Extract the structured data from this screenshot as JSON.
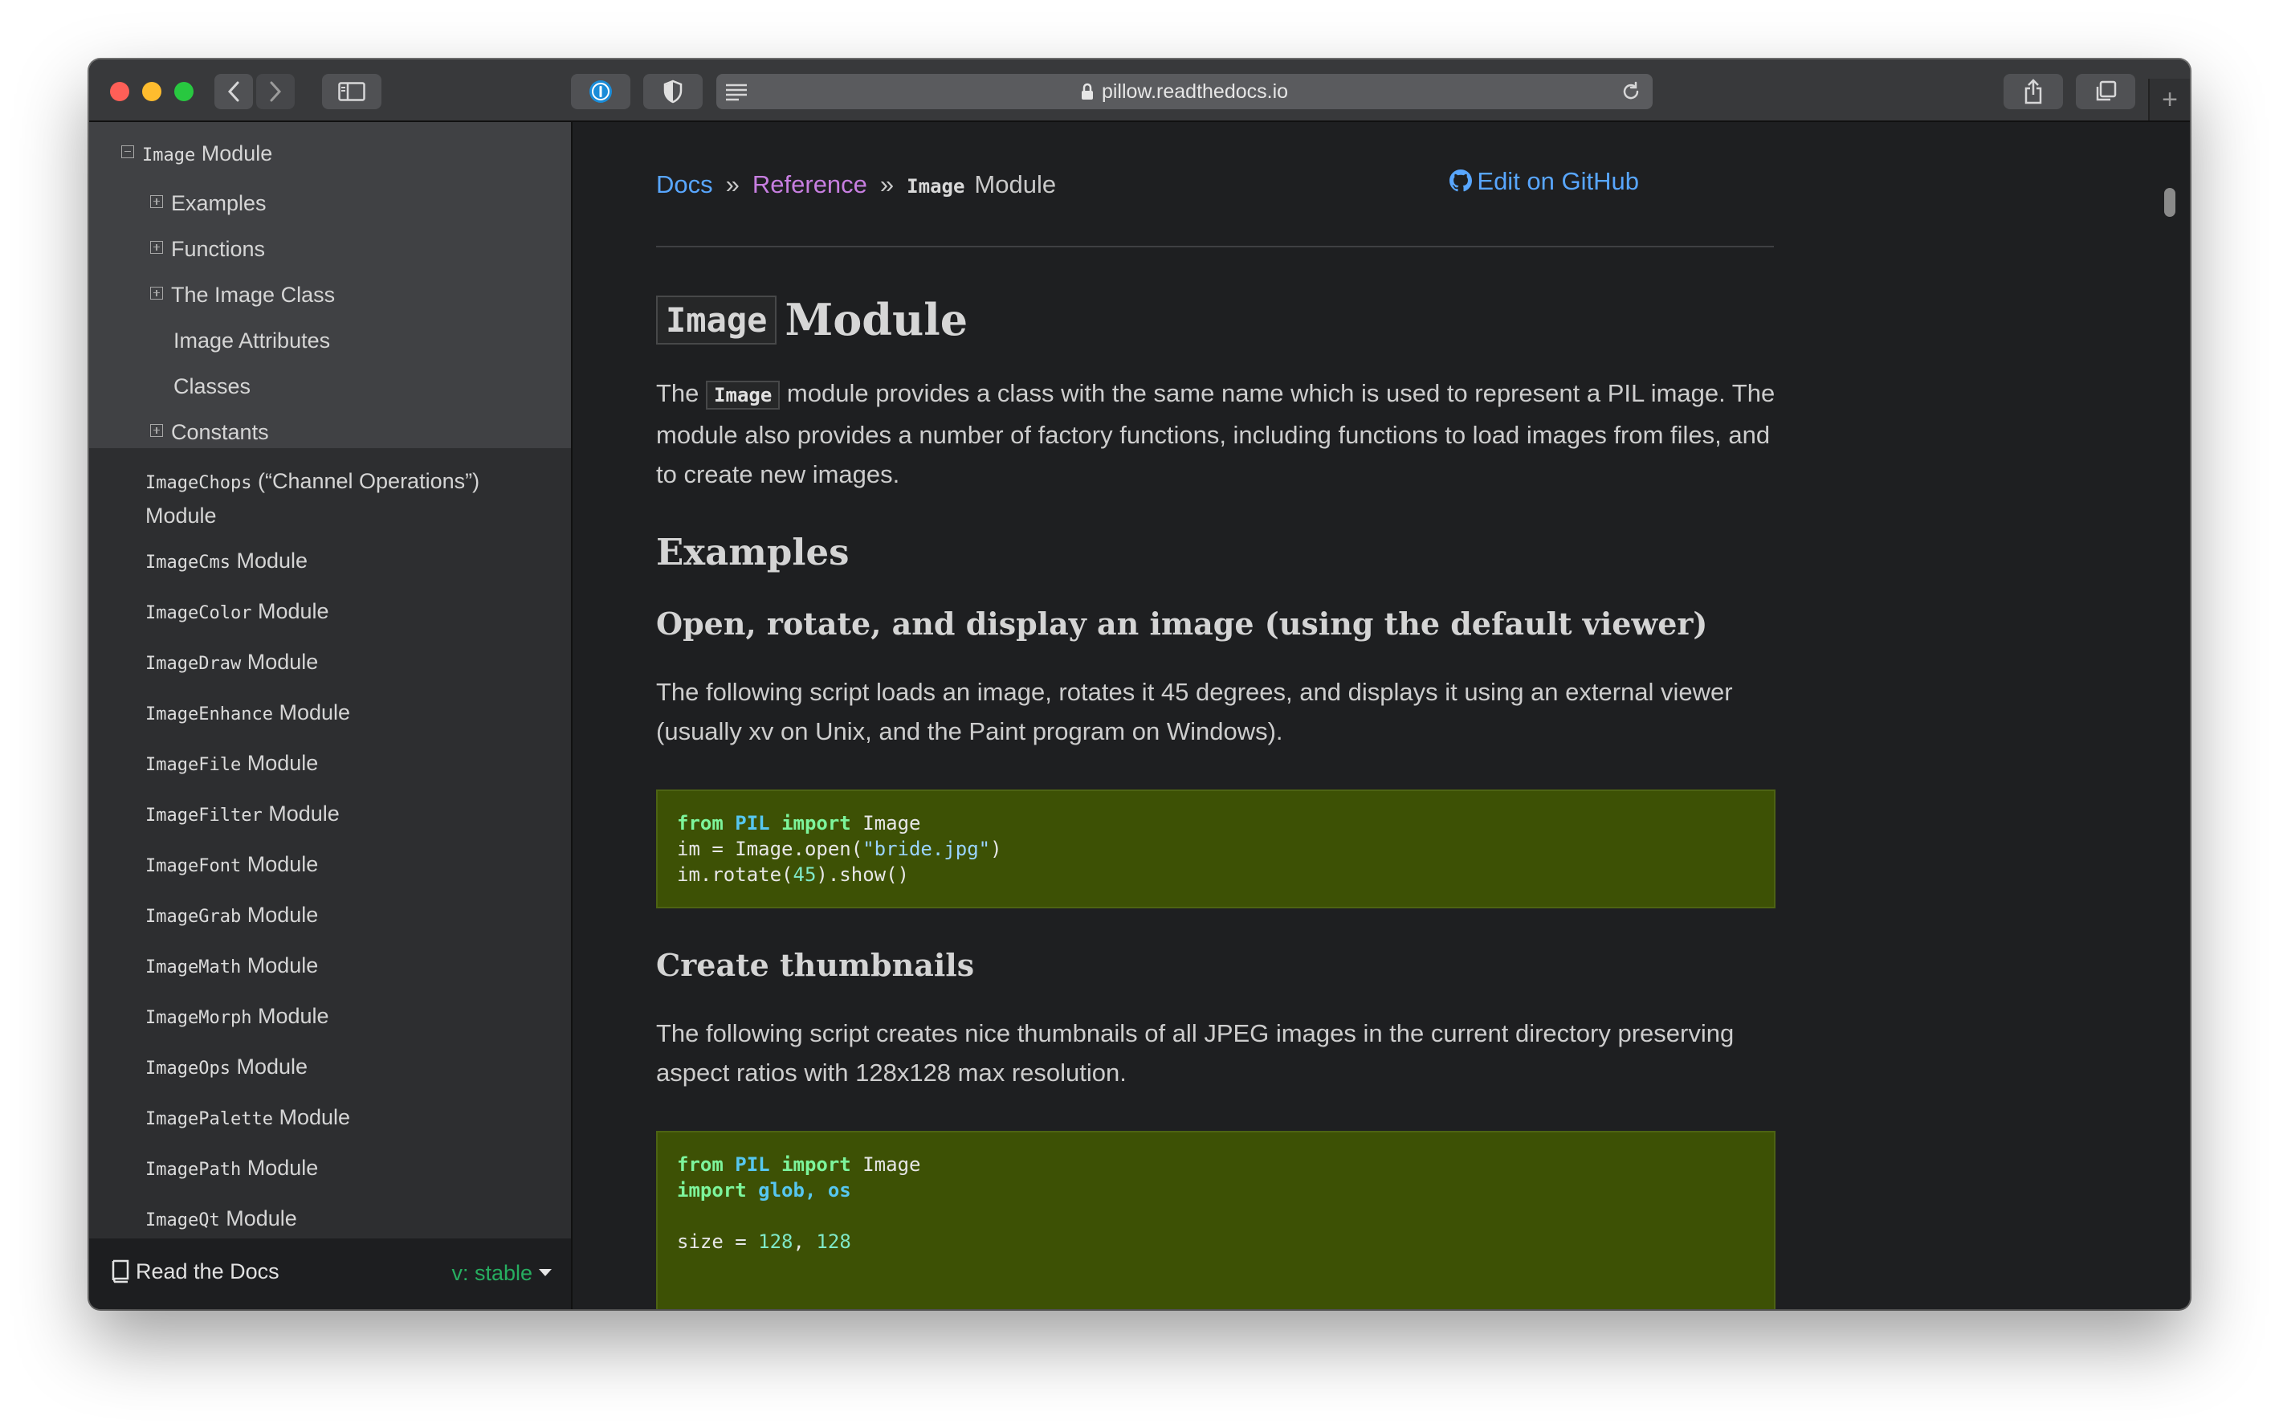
{
  "browser": {
    "url": "pillow.readthedocs.io",
    "colors": {
      "close": "#fe5f57",
      "minimize": "#febc2e",
      "maximize": "#28c840"
    },
    "new_tab": "+"
  },
  "sidebar": {
    "current": {
      "code": "Image",
      "label": "Module",
      "children": [
        {
          "label": "Examples",
          "expandable": true
        },
        {
          "label": "Functions",
          "expandable": true
        },
        {
          "label": "The Image Class",
          "expandable": true
        },
        {
          "label": "Image Attributes",
          "expandable": false
        },
        {
          "label": "Classes",
          "expandable": false
        },
        {
          "label": "Constants",
          "expandable": true
        }
      ]
    },
    "modules": [
      {
        "code": "ImageChops",
        "label": "(“Channel Operations”)",
        "label2": "Module"
      },
      {
        "code": "ImageCms",
        "label": "Module"
      },
      {
        "code": "ImageColor",
        "label": "Module"
      },
      {
        "code": "ImageDraw",
        "label": "Module"
      },
      {
        "code": "ImageEnhance",
        "label": "Module"
      },
      {
        "code": "ImageFile",
        "label": "Module"
      },
      {
        "code": "ImageFilter",
        "label": "Module"
      },
      {
        "code": "ImageFont",
        "label": "Module"
      },
      {
        "code": "ImageGrab",
        "label": "Module"
      },
      {
        "code": "ImageMath",
        "label": "Module"
      },
      {
        "code": "ImageMorph",
        "label": "Module"
      },
      {
        "code": "ImageOps",
        "label": "Module"
      },
      {
        "code": "ImagePalette",
        "label": "Module"
      },
      {
        "code": "ImagePath",
        "label": "Module"
      },
      {
        "code": "ImageQt",
        "label": "Module"
      }
    ],
    "footer": {
      "label": "Read the Docs",
      "version": "v: stable"
    }
  },
  "breadcrumb": {
    "docs": "Docs",
    "sep": "»",
    "reference": "Reference",
    "current_code": "Image",
    "current_label": "Module",
    "edit": "Edit on GitHub",
    "colors": {
      "docs": "#58a6ff",
      "reference": "#c77ee0"
    }
  },
  "page": {
    "title_code": "Image",
    "title_text": "Module",
    "intro_pre": "The",
    "intro_code": "Image",
    "intro_post": "module provides a class with the same name which is used to represent a PIL image. The module also provides a number of factory functions, including functions to load images from files, and to create new images.",
    "examples_heading": "Examples",
    "ex1_heading": "Open, rotate, and display an image (using the default viewer)",
    "ex1_text": "The following script loads an image, rotates it 45 degrees, and displays it using an external viewer (usually xv on Unix, and the Paint program on Windows).",
    "ex1_code": {
      "l1_from": "from",
      "l1_pil": "PIL",
      "l1_import": "import",
      "l1_image": "Image",
      "l2_pre": "im = Image.open(",
      "l2_str": "\"bride.jpg\"",
      "l2_post": ")",
      "l3_pre": "im.rotate(",
      "l3_num": "45",
      "l3_post": ").show()"
    },
    "ex2_heading": "Create thumbnails",
    "ex2_text": "The following script creates nice thumbnails of all JPEG images in the current directory preserving aspect ratios with 128x128 max resolution.",
    "ex2_code": {
      "l1_from": "from",
      "l1_pil": "PIL",
      "l1_import": "import",
      "l1_image": "Image",
      "l2_import": "import",
      "l2_mods": "glob, os",
      "l4_pre": "size = ",
      "l4_a": "128",
      "l4_comma": ", ",
      "l4_b": "128"
    }
  }
}
